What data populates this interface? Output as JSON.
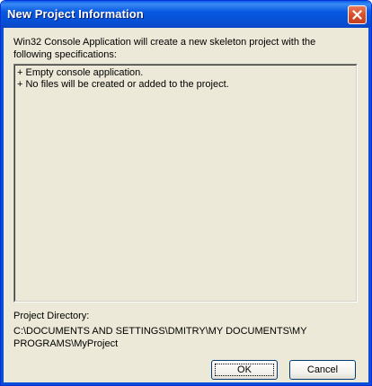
{
  "window": {
    "title": "New Project Information"
  },
  "description": "Win32 Console Application will create a new skeleton project with the following specifications:",
  "specifications": [
    "+ Empty console application.",
    "+ No files will be created or added to the project."
  ],
  "project_directory": {
    "label": "Project Directory:",
    "value": "C:\\DOCUMENTS AND SETTINGS\\DMITRY\\MY DOCUMENTS\\MY PROGRAMS\\MyProject"
  },
  "buttons": {
    "ok_label": "OK",
    "cancel_label": "Cancel"
  },
  "colors": {
    "titlebar": "#0859e0",
    "dialog_background": "#ece9d8",
    "close_button": "#d8502d"
  },
  "icons": {
    "close": "close-icon"
  }
}
